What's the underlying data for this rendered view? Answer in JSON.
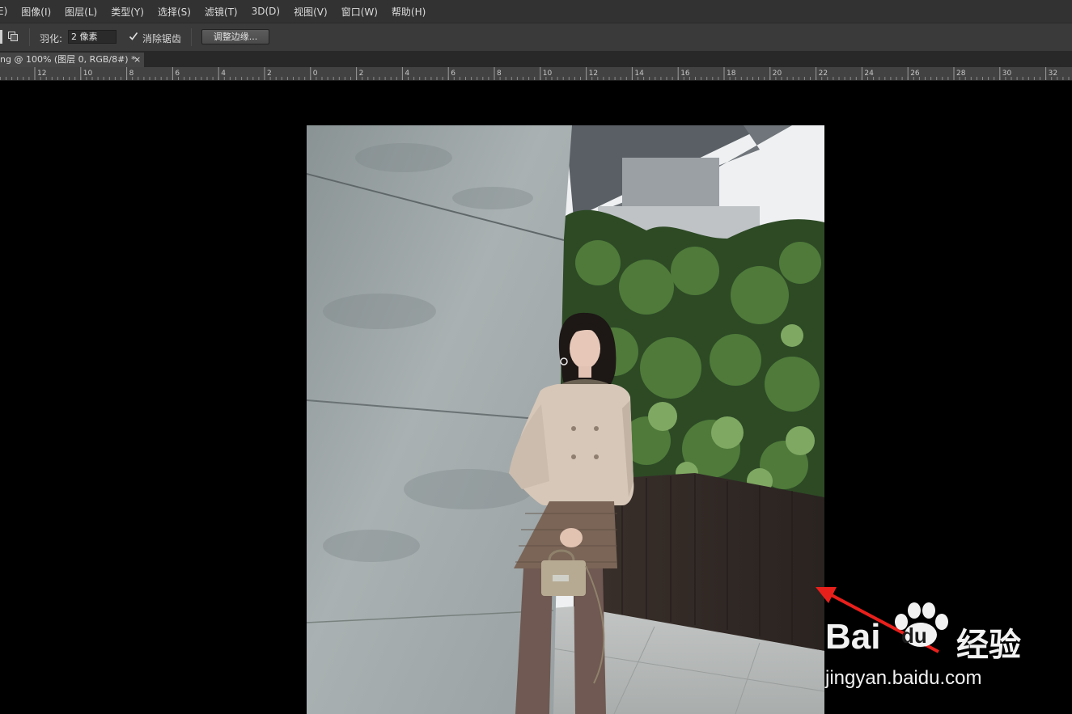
{
  "menu": [
    "E)",
    "图像(I)",
    "图层(L)",
    "类型(Y)",
    "选择(S)",
    "滤镜(T)",
    "3D(D)",
    "视图(V)",
    "窗口(W)",
    "帮助(H)"
  ],
  "options": {
    "feather_label": "羽化:",
    "feather_value": "2 像素",
    "antialias_label": "消除锯齿",
    "antialias_checked": true,
    "refine_edge_label": "调整边缘..."
  },
  "document_tab": {
    "title": "ng @ 100% (图层 0, RGB/8#) *",
    "close_glyph": "×"
  },
  "ruler": {
    "labels": [
      "12",
      "10",
      "8",
      "6",
      "4",
      "2",
      "0",
      "2",
      "4",
      "6",
      "8",
      "10",
      "12",
      "14",
      "16",
      "18",
      "20",
      "22",
      "24",
      "26",
      "28",
      "30",
      "32"
    ]
  },
  "watermark": {
    "brand_left": "Bai",
    "brand_right": "du",
    "brand_cn": "经验",
    "url": "jingyan.baidu.com"
  },
  "colors": {
    "menu_bg": "#323232",
    "options_bg": "#3a3a3a",
    "canvas_bg": "#000000",
    "arrow": "#e8201c"
  }
}
